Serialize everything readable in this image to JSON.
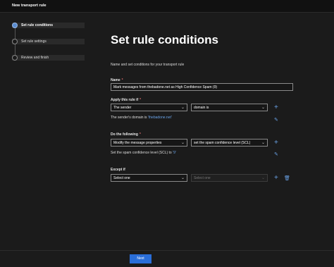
{
  "window": {
    "title": "New transport rule"
  },
  "steps": [
    {
      "label": "Set rule conditions",
      "active": true
    },
    {
      "label": "Set rule settings",
      "active": false
    },
    {
      "label": "Review and finish",
      "active": false
    }
  ],
  "main": {
    "title": "Set rule conditions",
    "description": "Name and set conditions for your transport rule",
    "name": {
      "label": "Name",
      "value": "Mark messages from thebadone.net as High Confidence Spam (9)"
    },
    "apply_if": {
      "label": "Apply this rule if",
      "condition": "The sender",
      "predicate": "domain is",
      "info_prefix": "The sender's domain is",
      "info_link": "'thebadone.net'"
    },
    "do_following": {
      "label": "Do the following",
      "action": "Modify the message properties",
      "sub_action": "set the spam confidence level (SCL)",
      "info_prefix": "Set the spam confidence level (SCL) to",
      "info_link": "'9'"
    },
    "except_if": {
      "label": "Except if",
      "condition": "Select one",
      "predicate": "Select one"
    }
  },
  "footer": {
    "next_label": "Next"
  },
  "icons": {
    "add": "plus-icon",
    "edit": "pencil-icon",
    "delete": "trash-icon",
    "dropdown": "chevron-down-icon"
  }
}
